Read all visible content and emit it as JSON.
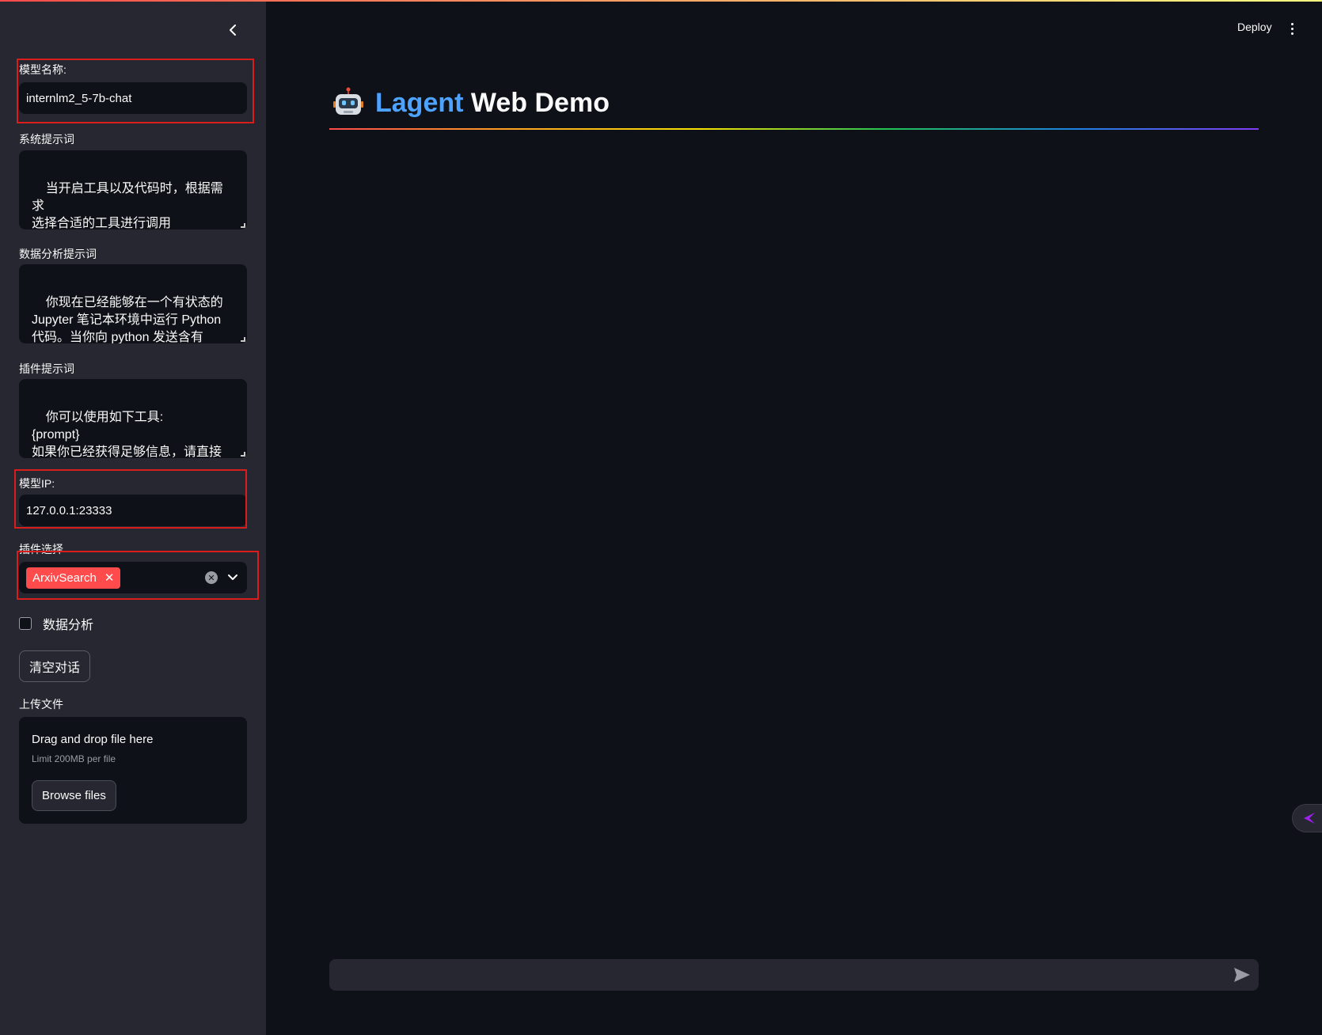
{
  "sidebar": {
    "collapse_icon": "chevron-left-icon",
    "model_name": {
      "label": "模型名称:",
      "value": "internlm2_5-7b-chat"
    },
    "system_prompt": {
      "label": "系统提示词",
      "value": "当开启工具以及代码时，根据需求\n选择合适的工具进行调用"
    },
    "data_analysis_prompt": {
      "label": "数据分析提示词",
      "value": "你现在已经能够在一个有状态的\nJupyter 笔记本环境中运行 Python\n代码。当你向 python 发送含有\nPython 代码的消息时，它将在该环"
    },
    "plugin_prompt": {
      "label": "插件提示词",
      "value": "你可以使用如下工具:\n{prompt}\n如果你已经获得足够信息，请直接\n给出答案. 避免不必要的工具调用!"
    },
    "model_ip": {
      "label": "模型IP:",
      "value": "127.0.0.1:23333"
    },
    "plugin_select": {
      "label": "插件选择",
      "selected": [
        "ArxivSearch"
      ]
    },
    "data_analysis_checkbox": {
      "label": "数据分析",
      "checked": false
    },
    "clear_button": "清空对话",
    "upload": {
      "label": "上传文件",
      "title": "Drag and drop file here",
      "limit": "Limit 200MB per file",
      "browse": "Browse files"
    }
  },
  "header": {
    "deploy": "Deploy",
    "menu_icon": "kebab-menu-icon"
  },
  "main": {
    "title_icon": "robot-icon",
    "title_accent": "Lagent",
    "title_rest": " Web Demo",
    "chat_input_placeholder": "",
    "send_icon": "send-icon"
  },
  "colors": {
    "background": "#0e1117",
    "sidebar": "#262730",
    "accent_red": "#ff4b4b",
    "title_accent": "#4da3ff",
    "highlight_box": "#d91d1d"
  }
}
